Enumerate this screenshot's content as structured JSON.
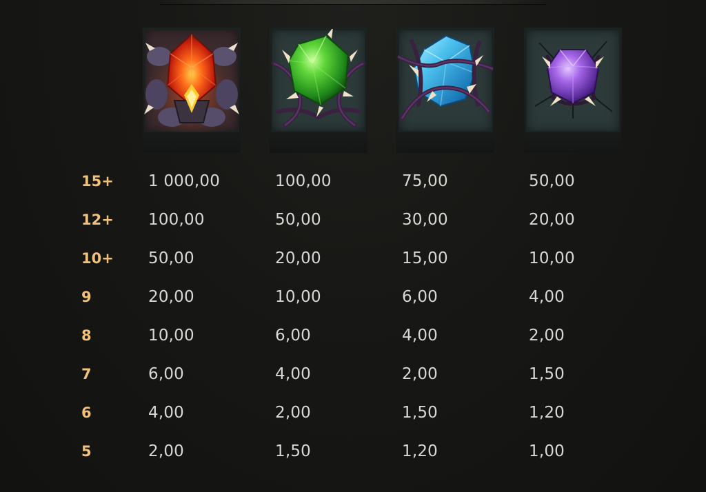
{
  "symbols": [
    {
      "name": "red-gem",
      "color": "#e8421a"
    },
    {
      "name": "green-gem",
      "color": "#3fb52a"
    },
    {
      "name": "blue-gem",
      "color": "#3aa8d8"
    },
    {
      "name": "purple-gem",
      "color": "#8a4fd0"
    }
  ],
  "label_color": "#f2c27a",
  "value_color": "#d8d8d4",
  "rows": [
    {
      "label": "15+",
      "values": [
        "1 000,00",
        "100,00",
        "75,00",
        "50,00"
      ]
    },
    {
      "label": "12+",
      "values": [
        "100,00",
        "50,00",
        "30,00",
        "20,00"
      ]
    },
    {
      "label": "10+",
      "values": [
        "50,00",
        "20,00",
        "15,00",
        "10,00"
      ]
    },
    {
      "label": "9",
      "values": [
        "20,00",
        "10,00",
        "6,00",
        "4,00"
      ]
    },
    {
      "label": "8",
      "values": [
        "10,00",
        "6,00",
        "4,00",
        "2,00"
      ]
    },
    {
      "label": "7",
      "values": [
        "6,00",
        "4,00",
        "2,00",
        "1,50"
      ]
    },
    {
      "label": "6",
      "values": [
        "4,00",
        "2,00",
        "1,50",
        "1,20"
      ]
    },
    {
      "label": "5",
      "values": [
        "2,00",
        "1,50",
        "1,20",
        "1,00"
      ]
    }
  ]
}
